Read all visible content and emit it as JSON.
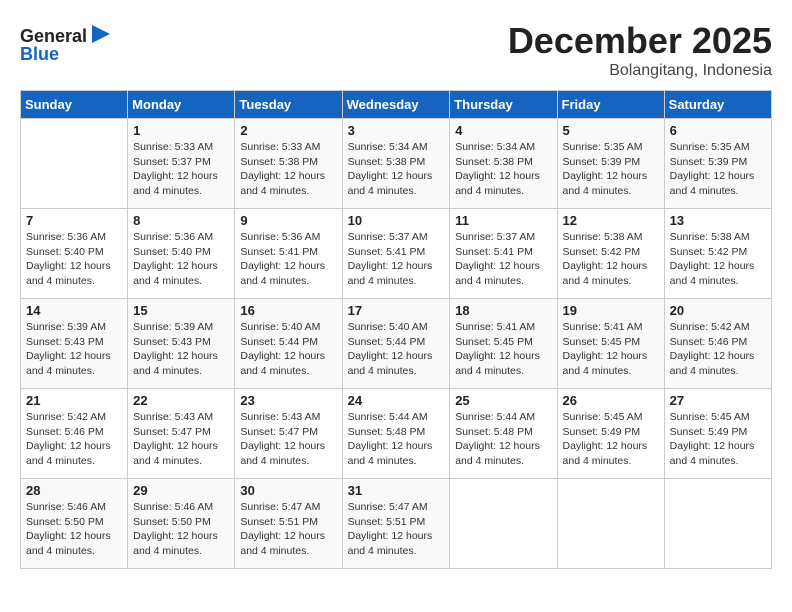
{
  "header": {
    "logo_line1": "General",
    "logo_line2": "Blue",
    "month_title": "December 2025",
    "location": "Bolangitang, Indonesia"
  },
  "weekdays": [
    "Sunday",
    "Monday",
    "Tuesday",
    "Wednesday",
    "Thursday",
    "Friday",
    "Saturday"
  ],
  "weeks": [
    [
      {
        "day": "",
        "info": ""
      },
      {
        "day": "1",
        "info": "Sunrise: 5:33 AM\nSunset: 5:37 PM\nDaylight: 12 hours\nand 4 minutes."
      },
      {
        "day": "2",
        "info": "Sunrise: 5:33 AM\nSunset: 5:38 PM\nDaylight: 12 hours\nand 4 minutes."
      },
      {
        "day": "3",
        "info": "Sunrise: 5:34 AM\nSunset: 5:38 PM\nDaylight: 12 hours\nand 4 minutes."
      },
      {
        "day": "4",
        "info": "Sunrise: 5:34 AM\nSunset: 5:38 PM\nDaylight: 12 hours\nand 4 minutes."
      },
      {
        "day": "5",
        "info": "Sunrise: 5:35 AM\nSunset: 5:39 PM\nDaylight: 12 hours\nand 4 minutes."
      },
      {
        "day": "6",
        "info": "Sunrise: 5:35 AM\nSunset: 5:39 PM\nDaylight: 12 hours\nand 4 minutes."
      }
    ],
    [
      {
        "day": "7",
        "info": "Sunrise: 5:36 AM\nSunset: 5:40 PM\nDaylight: 12 hours\nand 4 minutes."
      },
      {
        "day": "8",
        "info": "Sunrise: 5:36 AM\nSunset: 5:40 PM\nDaylight: 12 hours\nand 4 minutes."
      },
      {
        "day": "9",
        "info": "Sunrise: 5:36 AM\nSunset: 5:41 PM\nDaylight: 12 hours\nand 4 minutes."
      },
      {
        "day": "10",
        "info": "Sunrise: 5:37 AM\nSunset: 5:41 PM\nDaylight: 12 hours\nand 4 minutes."
      },
      {
        "day": "11",
        "info": "Sunrise: 5:37 AM\nSunset: 5:41 PM\nDaylight: 12 hours\nand 4 minutes."
      },
      {
        "day": "12",
        "info": "Sunrise: 5:38 AM\nSunset: 5:42 PM\nDaylight: 12 hours\nand 4 minutes."
      },
      {
        "day": "13",
        "info": "Sunrise: 5:38 AM\nSunset: 5:42 PM\nDaylight: 12 hours\nand 4 minutes."
      }
    ],
    [
      {
        "day": "14",
        "info": "Sunrise: 5:39 AM\nSunset: 5:43 PM\nDaylight: 12 hours\nand 4 minutes."
      },
      {
        "day": "15",
        "info": "Sunrise: 5:39 AM\nSunset: 5:43 PM\nDaylight: 12 hours\nand 4 minutes."
      },
      {
        "day": "16",
        "info": "Sunrise: 5:40 AM\nSunset: 5:44 PM\nDaylight: 12 hours\nand 4 minutes."
      },
      {
        "day": "17",
        "info": "Sunrise: 5:40 AM\nSunset: 5:44 PM\nDaylight: 12 hours\nand 4 minutes."
      },
      {
        "day": "18",
        "info": "Sunrise: 5:41 AM\nSunset: 5:45 PM\nDaylight: 12 hours\nand 4 minutes."
      },
      {
        "day": "19",
        "info": "Sunrise: 5:41 AM\nSunset: 5:45 PM\nDaylight: 12 hours\nand 4 minutes."
      },
      {
        "day": "20",
        "info": "Sunrise: 5:42 AM\nSunset: 5:46 PM\nDaylight: 12 hours\nand 4 minutes."
      }
    ],
    [
      {
        "day": "21",
        "info": "Sunrise: 5:42 AM\nSunset: 5:46 PM\nDaylight: 12 hours\nand 4 minutes."
      },
      {
        "day": "22",
        "info": "Sunrise: 5:43 AM\nSunset: 5:47 PM\nDaylight: 12 hours\nand 4 minutes."
      },
      {
        "day": "23",
        "info": "Sunrise: 5:43 AM\nSunset: 5:47 PM\nDaylight: 12 hours\nand 4 minutes."
      },
      {
        "day": "24",
        "info": "Sunrise: 5:44 AM\nSunset: 5:48 PM\nDaylight: 12 hours\nand 4 minutes."
      },
      {
        "day": "25",
        "info": "Sunrise: 5:44 AM\nSunset: 5:48 PM\nDaylight: 12 hours\nand 4 minutes."
      },
      {
        "day": "26",
        "info": "Sunrise: 5:45 AM\nSunset: 5:49 PM\nDaylight: 12 hours\nand 4 minutes."
      },
      {
        "day": "27",
        "info": "Sunrise: 5:45 AM\nSunset: 5:49 PM\nDaylight: 12 hours\nand 4 minutes."
      }
    ],
    [
      {
        "day": "28",
        "info": "Sunrise: 5:46 AM\nSunset: 5:50 PM\nDaylight: 12 hours\nand 4 minutes."
      },
      {
        "day": "29",
        "info": "Sunrise: 5:46 AM\nSunset: 5:50 PM\nDaylight: 12 hours\nand 4 minutes."
      },
      {
        "day": "30",
        "info": "Sunrise: 5:47 AM\nSunset: 5:51 PM\nDaylight: 12 hours\nand 4 minutes."
      },
      {
        "day": "31",
        "info": "Sunrise: 5:47 AM\nSunset: 5:51 PM\nDaylight: 12 hours\nand 4 minutes."
      },
      {
        "day": "",
        "info": ""
      },
      {
        "day": "",
        "info": ""
      },
      {
        "day": "",
        "info": ""
      }
    ]
  ]
}
